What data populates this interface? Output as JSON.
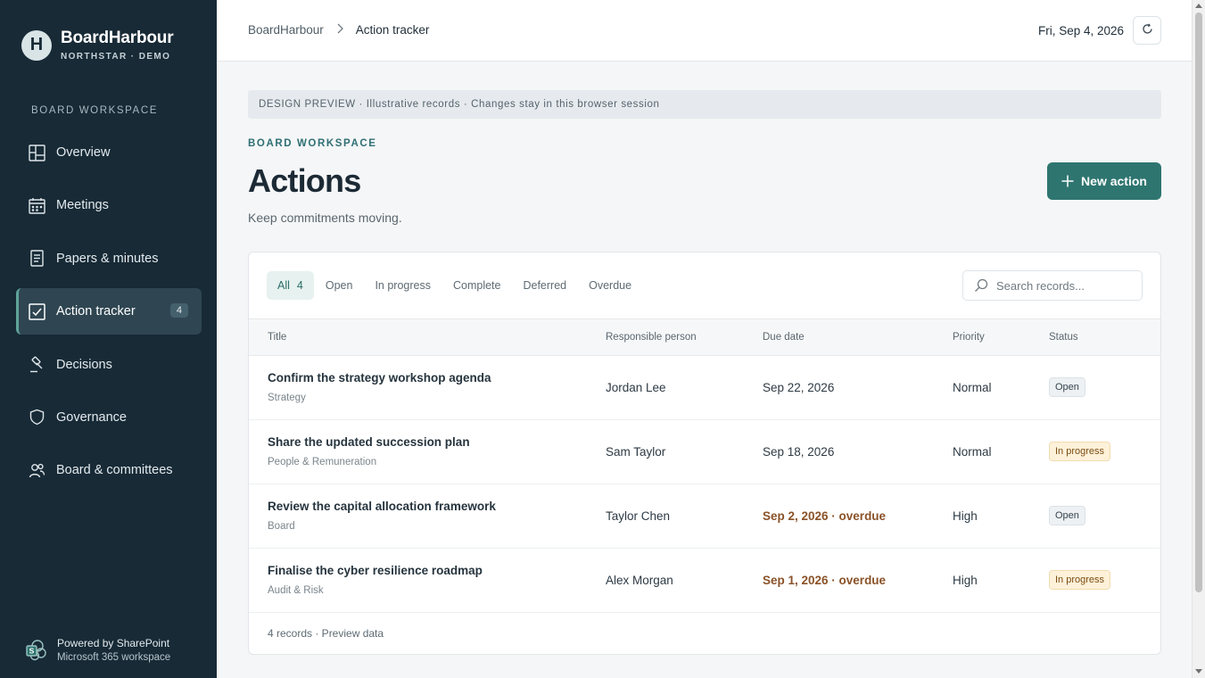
{
  "brand": {
    "logo_letter": "H",
    "name": "BoardHarbour",
    "subtitle": "NORTHSTAR · DEMO"
  },
  "sidebar": {
    "section_label": "BOARD WORKSPACE",
    "items": [
      {
        "label": "Overview",
        "icon": "layout-grid-icon"
      },
      {
        "label": "Meetings",
        "icon": "calendar-icon"
      },
      {
        "label": "Papers & minutes",
        "icon": "document-icon"
      },
      {
        "label": "Action tracker",
        "icon": "checkbox-icon",
        "badge": "4",
        "active": true
      },
      {
        "label": "Decisions",
        "icon": "gavel-icon"
      },
      {
        "label": "Governance",
        "icon": "shield-icon"
      },
      {
        "label": "Board & committees",
        "icon": "people-icon"
      }
    ],
    "footer": {
      "line1": "Powered by SharePoint",
      "line2": "Microsoft 365 workspace"
    }
  },
  "topbar": {
    "breadcrumb_root": "BoardHarbour",
    "breadcrumb_current": "Action tracker",
    "date": "Fri, Sep 4, 2026"
  },
  "banner": "DESIGN PREVIEW · Illustrative records · Changes stay in this browser session",
  "header": {
    "eyebrow": "BOARD WORKSPACE",
    "title": "Actions",
    "subtitle": "Keep commitments moving.",
    "new_button": "New action"
  },
  "filters": {
    "all_label": "All",
    "all_count": "4",
    "options": [
      "Open",
      "In progress",
      "Complete",
      "Deferred",
      "Overdue"
    ]
  },
  "search": {
    "placeholder": "Search records..."
  },
  "table": {
    "columns": [
      "Title",
      "Responsible person",
      "Due date",
      "Priority",
      "Status"
    ],
    "rows": [
      {
        "title": "Confirm the strategy workshop agenda",
        "category": "Strategy",
        "person": "Jordan Lee",
        "due": "Sep 22, 2026",
        "priority": "Normal",
        "status": "Open"
      },
      {
        "title": "Share the updated succession plan",
        "category": "People & Remuneration",
        "person": "Sam Taylor",
        "due": "Sep 18, 2026",
        "priority": "Normal",
        "status": "In progress"
      },
      {
        "title": "Review the capital allocation framework",
        "category": "Board",
        "person": "Taylor Chen",
        "due": "Sep 2, 2026 · overdue",
        "priority": "High",
        "status": "Open"
      },
      {
        "title": "Finalise the cyber resilience roadmap",
        "category": "Audit & Risk",
        "person": "Alex Morgan",
        "due": "Sep 1, 2026 · overdue",
        "priority": "High",
        "status": "In progress"
      }
    ],
    "footer": "4 records · Preview data"
  },
  "colors": {
    "sidebar": "#172a36",
    "accent": "#2e7570",
    "overdue": "#8a5228"
  }
}
